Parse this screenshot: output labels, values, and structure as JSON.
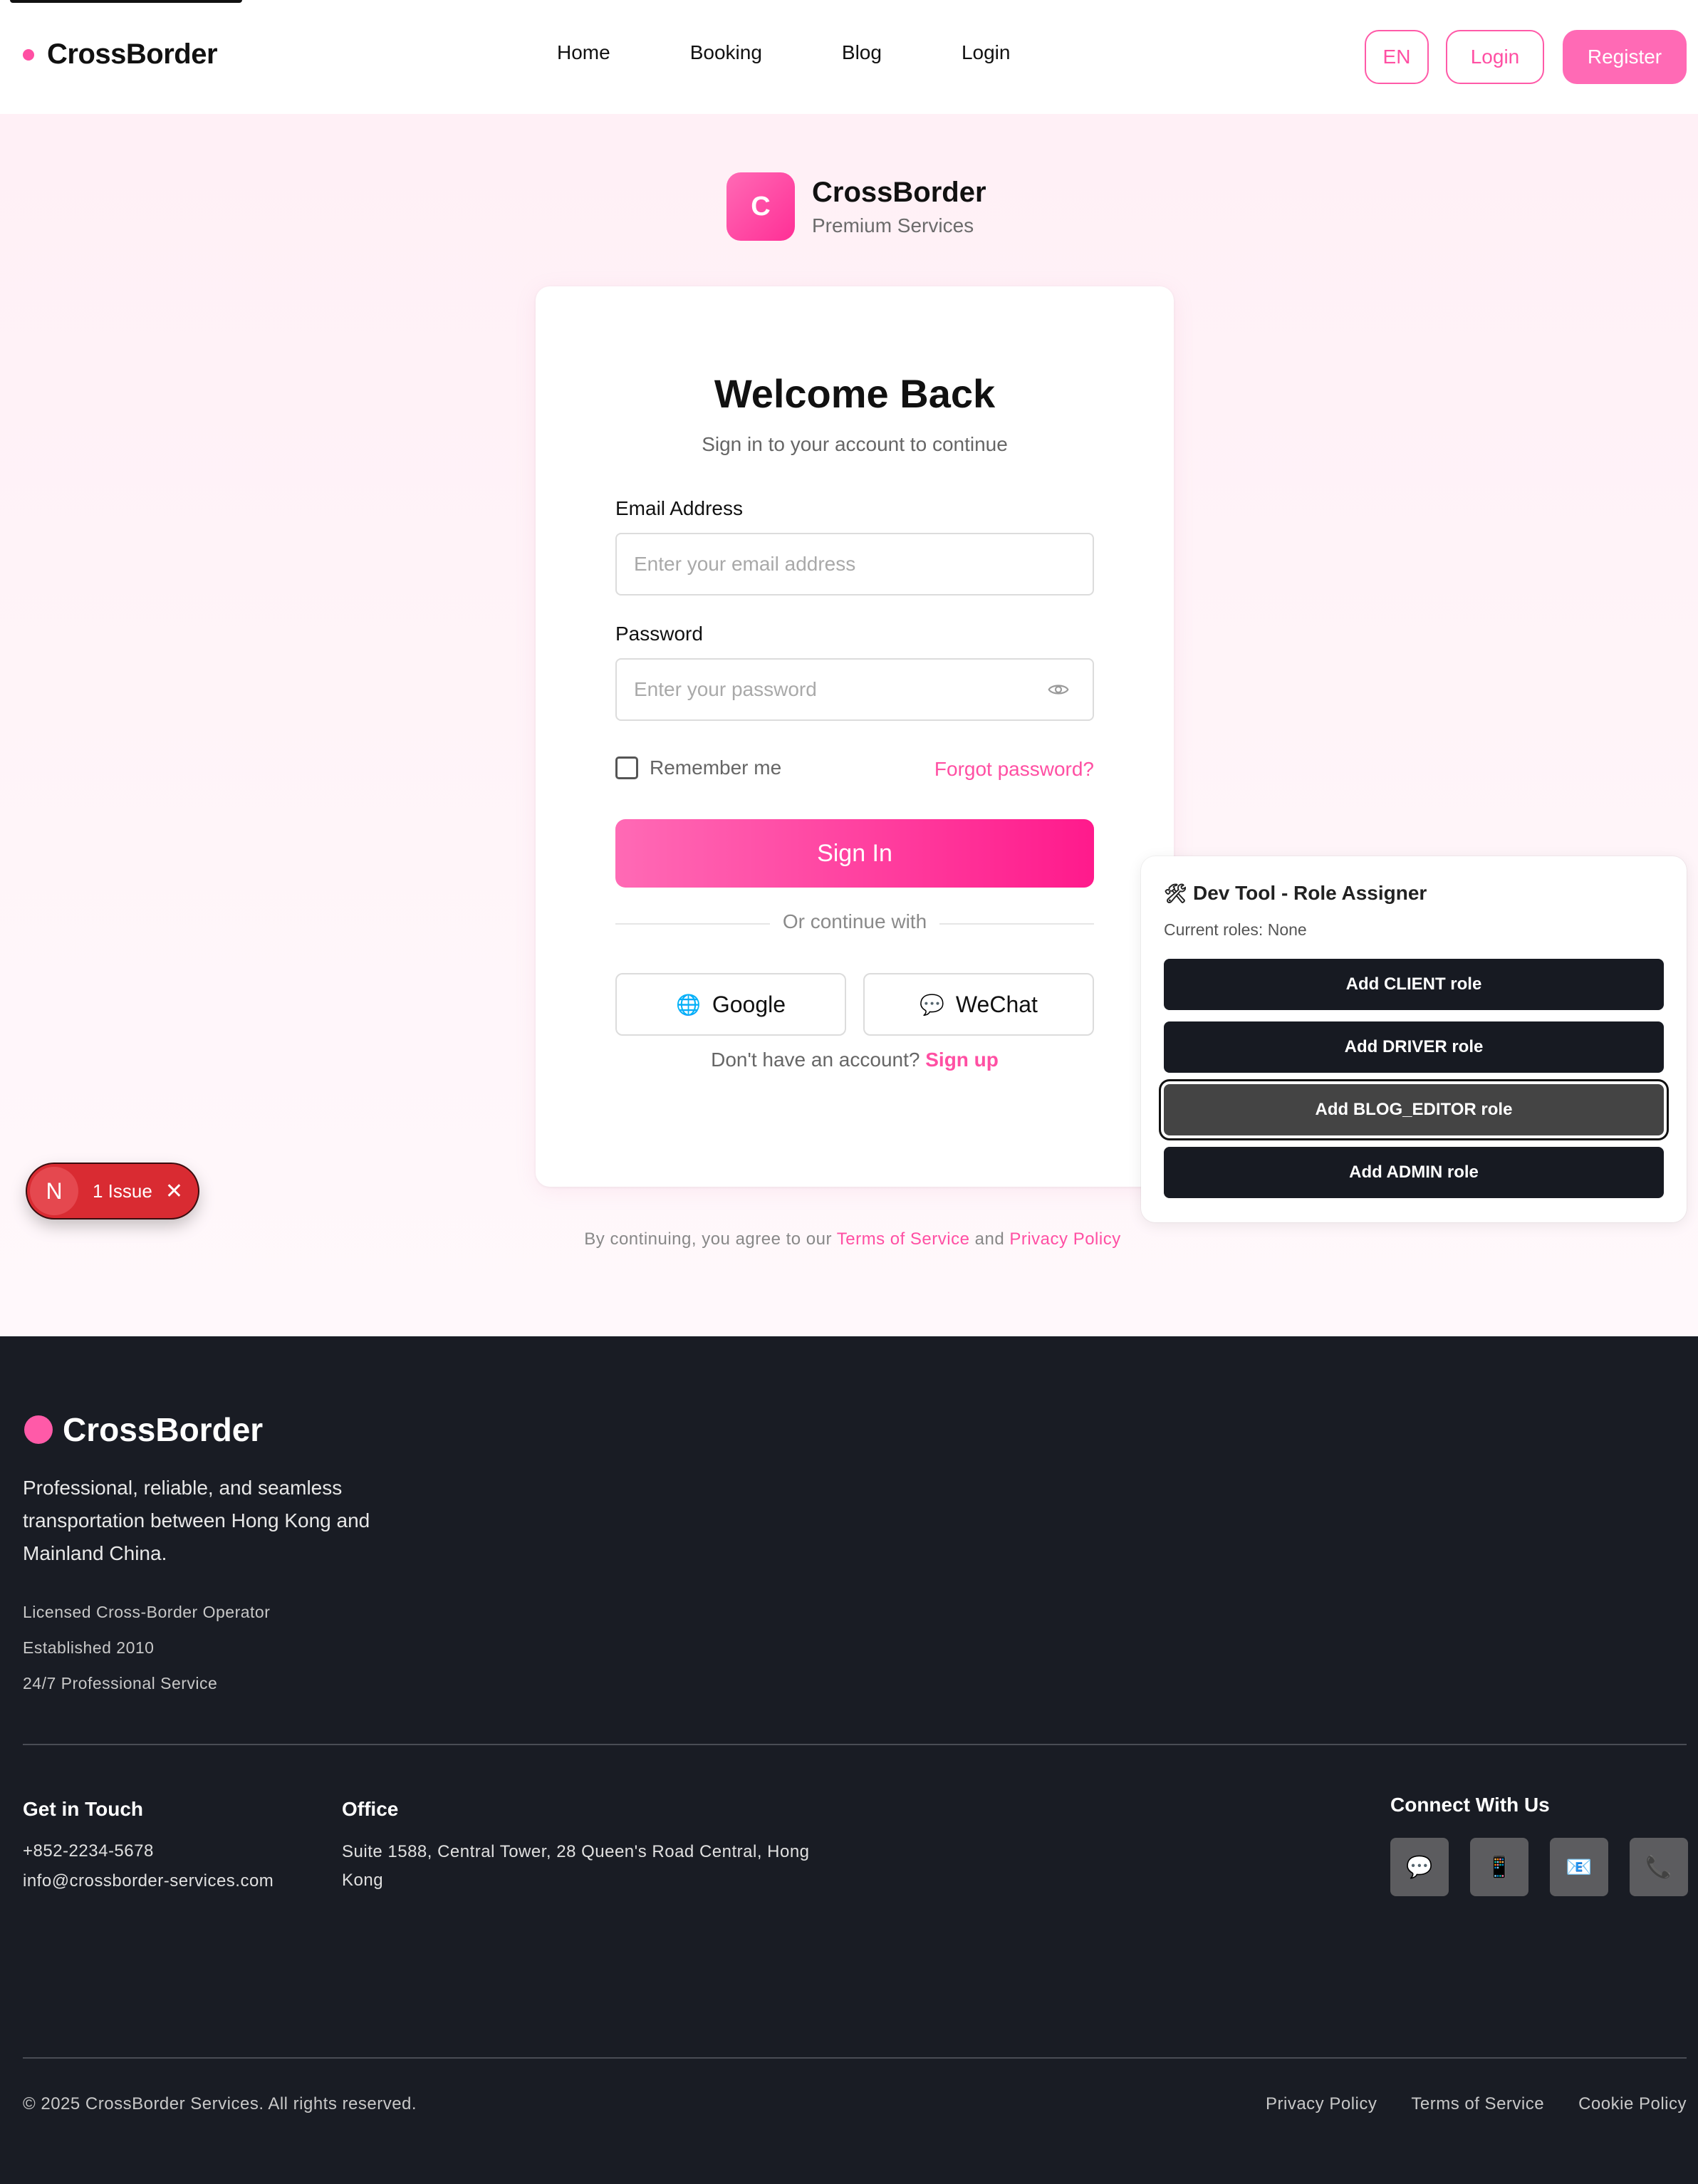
{
  "header": {
    "brand": "CrossBorder",
    "nav": [
      "Home",
      "Booking",
      "Blog",
      "Login"
    ],
    "lang_label": "EN",
    "login_label": "Login",
    "register_label": "Register"
  },
  "logo": {
    "letter": "C",
    "title": "CrossBorder",
    "subtitle": "Premium Services"
  },
  "form": {
    "title": "Welcome Back",
    "subtitle": "Sign in to your account to continue",
    "email_label": "Email Address",
    "email_placeholder": "Enter your email address",
    "password_label": "Password",
    "password_placeholder": "Enter your password",
    "remember_label": "Remember me",
    "forgot_label": "Forgot password?",
    "signin_label": "Sign In",
    "divider_label": "Or continue with",
    "google_label": "Google",
    "wechat_label": "WeChat",
    "no_account_text": "Don't have an account?",
    "signup_label": "Sign up"
  },
  "terms": {
    "prefix": "By continuing, you agree to our",
    "tos": "Terms of Service",
    "and": "and",
    "privacy": "Privacy Policy"
  },
  "devtool": {
    "icon": "🛠",
    "title": "Dev Tool - Role Assigner",
    "current_roles": "Current roles: None",
    "buttons": [
      "Add CLIENT role",
      "Add DRIVER role",
      "Add BLOG_EDITOR role",
      "Add ADMIN role"
    ]
  },
  "issue_badge": {
    "letter": "N",
    "text": "1 Issue"
  },
  "footer": {
    "brand": "CrossBorder",
    "description": "Professional, reliable, and seamless transportation between Hong Kong and Mainland China.",
    "facts": [
      "Licensed Cross-Border Operator",
      "Established 2010",
      "24/7 Professional Service"
    ],
    "get_in_touch_title": "Get in Touch",
    "phone": "+852-2234-5678",
    "email": "info@crossborder-services.com",
    "office_title": "Office",
    "office_address": "Suite 1588, Central Tower, 28 Queen's Road Central, Hong Kong",
    "connect_title": "Connect With Us",
    "social_icons": [
      "💬",
      "📱",
      "📧",
      "📞"
    ],
    "copyright": "© 2025 CrossBorder Services. All rights reserved.",
    "links": [
      "Privacy Policy",
      "Terms of Service",
      "Cookie Policy"
    ]
  },
  "colors": {
    "accent": "#ff4fa3",
    "footer_bg": "#191c24",
    "devtool_button": "#171a22",
    "issue_red": "#d92b32"
  }
}
